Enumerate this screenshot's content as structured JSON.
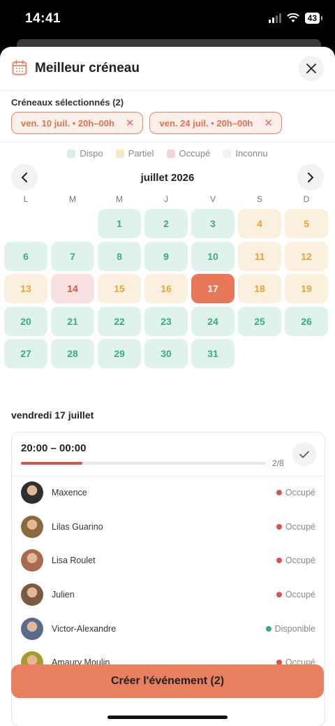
{
  "status_bar": {
    "time": "14:41",
    "battery": "43"
  },
  "header": {
    "title": "Meilleur créneau"
  },
  "selection": {
    "label": "Créneaux sélectionnés (2)",
    "chips": [
      {
        "label": "ven. 10 juil. • 20h–00h"
      },
      {
        "label": "ven. 24 juil. • 20h–00h"
      }
    ]
  },
  "legend": [
    {
      "label": "Dispo",
      "color": "#d7efe6"
    },
    {
      "label": "Partiel",
      "color": "#f8e6c8"
    },
    {
      "label": "Occupé",
      "color": "#f5d3d3"
    },
    {
      "label": "Inconnu",
      "color": "#f2f2f2"
    }
  ],
  "calendar": {
    "month": "juillet 2026",
    "weekdays": [
      "L",
      "M",
      "M",
      "J",
      "V",
      "S",
      "D"
    ],
    "leading_empty": 2,
    "days": [
      {
        "n": "1",
        "s": "dispo"
      },
      {
        "n": "2",
        "s": "dispo"
      },
      {
        "n": "3",
        "s": "dispo"
      },
      {
        "n": "4",
        "s": "partiel"
      },
      {
        "n": "5",
        "s": "partiel"
      },
      {
        "n": "6",
        "s": "dispo"
      },
      {
        "n": "7",
        "s": "dispo"
      },
      {
        "n": "8",
        "s": "dispo"
      },
      {
        "n": "9",
        "s": "dispo"
      },
      {
        "n": "10",
        "s": "dispo"
      },
      {
        "n": "11",
        "s": "partiel"
      },
      {
        "n": "12",
        "s": "partiel"
      },
      {
        "n": "13",
        "s": "partiel"
      },
      {
        "n": "14",
        "s": "occupe"
      },
      {
        "n": "15",
        "s": "partiel"
      },
      {
        "n": "16",
        "s": "partiel"
      },
      {
        "n": "17",
        "s": "selected"
      },
      {
        "n": "18",
        "s": "partiel"
      },
      {
        "n": "19",
        "s": "partiel"
      },
      {
        "n": "20",
        "s": "dispo"
      },
      {
        "n": "21",
        "s": "dispo"
      },
      {
        "n": "22",
        "s": "dispo"
      },
      {
        "n": "23",
        "s": "dispo"
      },
      {
        "n": "24",
        "s": "dispo"
      },
      {
        "n": "25",
        "s": "dispo"
      },
      {
        "n": "26",
        "s": "dispo"
      },
      {
        "n": "27",
        "s": "dispo"
      },
      {
        "n": "28",
        "s": "dispo"
      },
      {
        "n": "29",
        "s": "dispo"
      },
      {
        "n": "30",
        "s": "dispo"
      },
      {
        "n": "31",
        "s": "dispo"
      }
    ]
  },
  "selected_date": "vendredi 17 juillet",
  "slot": {
    "time": "20:00 – 00:00",
    "ratio": "2/8",
    "progress": 0.25,
    "members": [
      {
        "name": "Maxence",
        "status": "Occupé",
        "status_color": "#d9534f"
      },
      {
        "name": "Lilas Guarino",
        "status": "Occupé",
        "status_color": "#d9534f"
      },
      {
        "name": "Lisa Roulet",
        "status": "Occupé",
        "status_color": "#d9534f"
      },
      {
        "name": "Julien",
        "status": "Occupé",
        "status_color": "#d9534f"
      },
      {
        "name": "Victor-Alexandre",
        "status": "Disponible",
        "status_color": "#3aaa84"
      },
      {
        "name": "Amaury Moulin",
        "status": "Occupé",
        "status_color": "#d9534f"
      }
    ]
  },
  "cta": {
    "label": "Créer l'événement (2)"
  },
  "colors": {
    "accent": "#e8805f",
    "dispo": "#dff3ec",
    "partiel": "#fbf0dd",
    "occupe": "#f9e1e0"
  }
}
